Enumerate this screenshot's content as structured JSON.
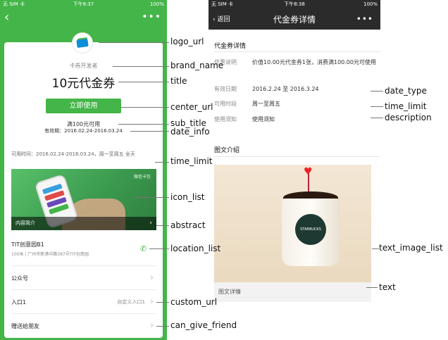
{
  "left": {
    "status": {
      "carrier": "无 SIM 卡",
      "time": "下午8:37",
      "battery": "100%"
    },
    "more": "•••",
    "card": {
      "brand": "卡券开发者",
      "title": "10元代金券",
      "button": "立即使用",
      "sub_title": "满100元可用",
      "date_info": "有效期：2016.02.24-2016.03.24",
      "valid_time": "可用时间：2016.02.24-2016.03.24，周一至周五 全天",
      "abstract": "内容简介",
      "banner_tag": "微信卡包",
      "location_name": "TIT创意园B1",
      "location_addr": "100米 | 广州市新港中路397号TIT创意园",
      "rows": [
        {
          "label": "公众号",
          "value": ""
        },
        {
          "label": "入口1",
          "value": "自定义入口1"
        },
        {
          "label": "赠送给朋友",
          "value": ""
        }
      ]
    }
  },
  "right": {
    "status": {
      "carrier": "无 SIM 卡",
      "time": "下午8:38",
      "battery": "100%"
    },
    "nav": {
      "back": "返回",
      "title": "代金券详情",
      "more": "•••"
    },
    "section1": "代金券详情",
    "details": [
      {
        "k": "优惠说明",
        "v": "价值10.00元代金券1张，消费满100.00元可使用"
      },
      {
        "k": "有效日期",
        "v": "2016.2.24 至 2016.3.24"
      },
      {
        "k": "可用时段",
        "v": "周一至周五"
      },
      {
        "k": "使用须知",
        "v": "使用须知"
      }
    ],
    "section2": "图文介绍",
    "photo_caption": "图文详情",
    "cup_brand": "STARBUCKS COFFEE"
  },
  "annotations": {
    "logo_url": "logo_url",
    "brand_name": "brand_name",
    "title": "title",
    "center_url": "center_url",
    "sub_title": "sub_title",
    "date_info": "date_info",
    "time_limit_left": "time_limit",
    "icon_list": "icon_list",
    "abstract": "abstract",
    "location_list": "location_list",
    "custom_url": "custom_url",
    "can_give_friend": "can_give_friend",
    "date_type": "date_type",
    "time_limit_right": "time_limit",
    "description": "description",
    "text_image_list": "text_image_list",
    "text": "text"
  },
  "colors": {
    "wechat_green": "#44b549",
    "nav_dark": "#2b2b2b"
  }
}
